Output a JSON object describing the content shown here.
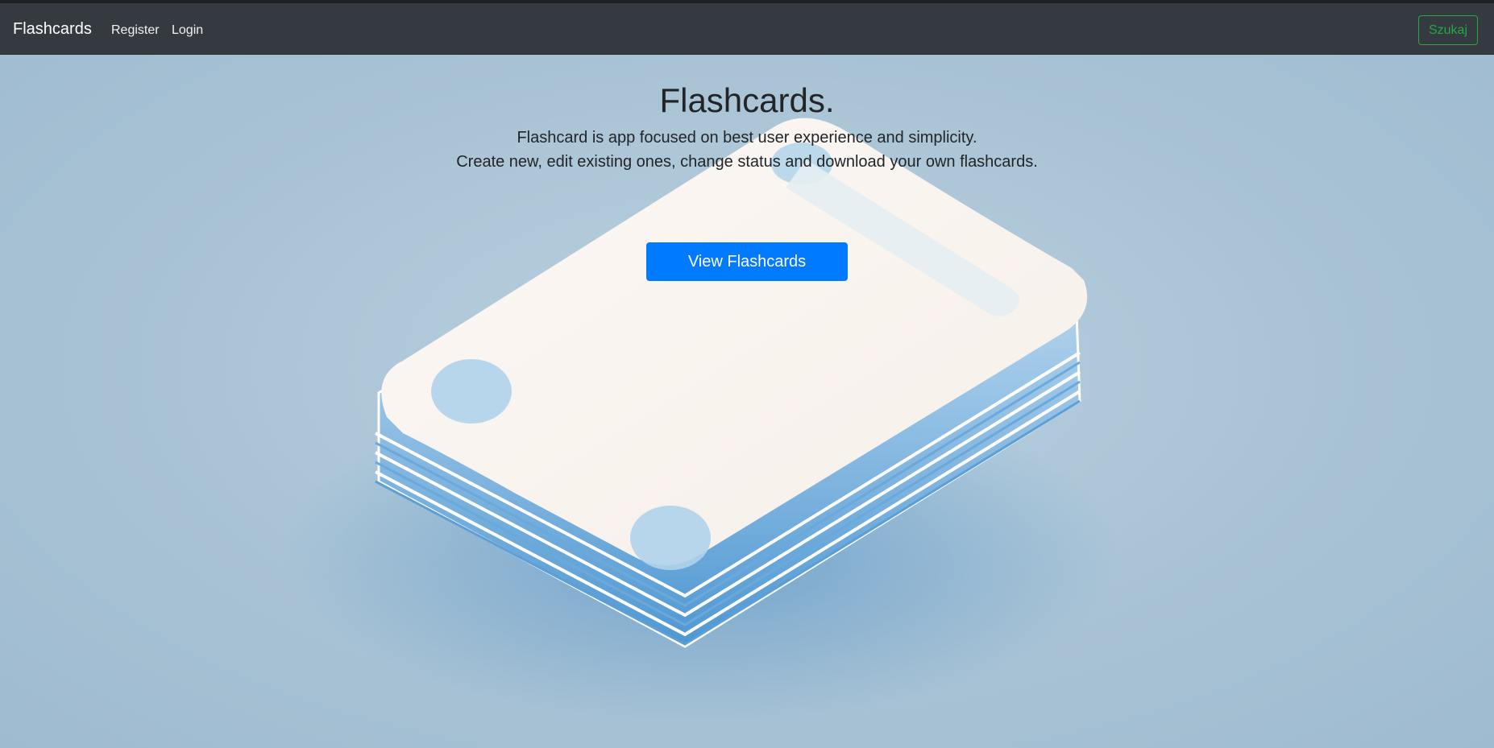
{
  "navbar": {
    "brand": "Flashcards",
    "links": [
      {
        "label": "Register"
      },
      {
        "label": "Login"
      }
    ],
    "search_button": "Szukaj"
  },
  "hero": {
    "title": "Flashcards.",
    "description_line1": "Flashcard is app focused on best user experience and simplicity.",
    "description_line2": "Create new, edit existing ones, change status and download your own flashcards.",
    "cta_button": "View Flashcards",
    "illustration": "flashcard-stack-illustration"
  },
  "colors": {
    "navbar_bg": "#343a40",
    "hero_bg": "#aac4d6",
    "primary": "#007bff",
    "success_outline": "#28a745",
    "card_face": "#f8f1ec",
    "card_edge": "#5a9fd6"
  }
}
